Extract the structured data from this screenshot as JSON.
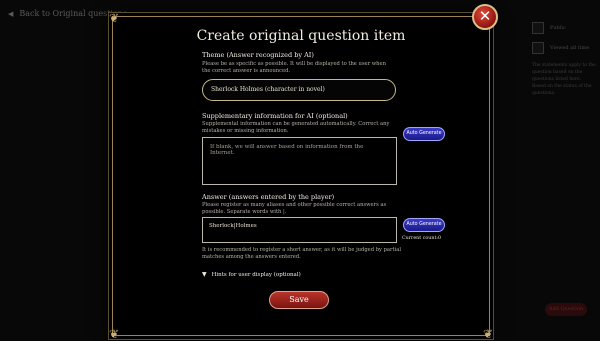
{
  "background": {
    "back_link": "Back to Original questions",
    "right_rows": [
      "Public",
      "Viewed all time"
    ],
    "right_notes": "The statements apply to the question based on the questions listed here. Based on the status of the questions.",
    "bottom_button": "Add Question"
  },
  "modal": {
    "title": "Create original question item",
    "close_icon": "close-icon",
    "theme": {
      "label": "Theme (Answer recognized by AI)",
      "help": "Please be as specific as possible. It will be displayed to the user when the correct answer is announced.",
      "value": "Sherlock Holmes (character in novel)"
    },
    "supplementary": {
      "label": "Supplementary information for AI (optional)",
      "help": "Supplemental information can be generated automatically. Correct any mistakes or missing information.",
      "placeholder": "If blank, we will answer based on information from the Internet.",
      "generate_button": "Auto Generate"
    },
    "answer": {
      "label": "Answer (answers entered by the player)",
      "help": "Please register as many aliases and other possible correct answers as possible. Separate words with |.",
      "value": "Sherlock|Holmes",
      "generate_button": "Auto Generate",
      "current_count": "Current count:0",
      "note": "It is recommended to register a short answer, as it will be judged by partial matches among the answers entered."
    },
    "hints_label": "Hints for user display (optional)",
    "save_button": "Save"
  },
  "colors": {
    "accent_gold": "#c9b078",
    "close_red": "#c0281e",
    "generate_blue": "#2a2ab0",
    "save_red": "#9a2218"
  }
}
